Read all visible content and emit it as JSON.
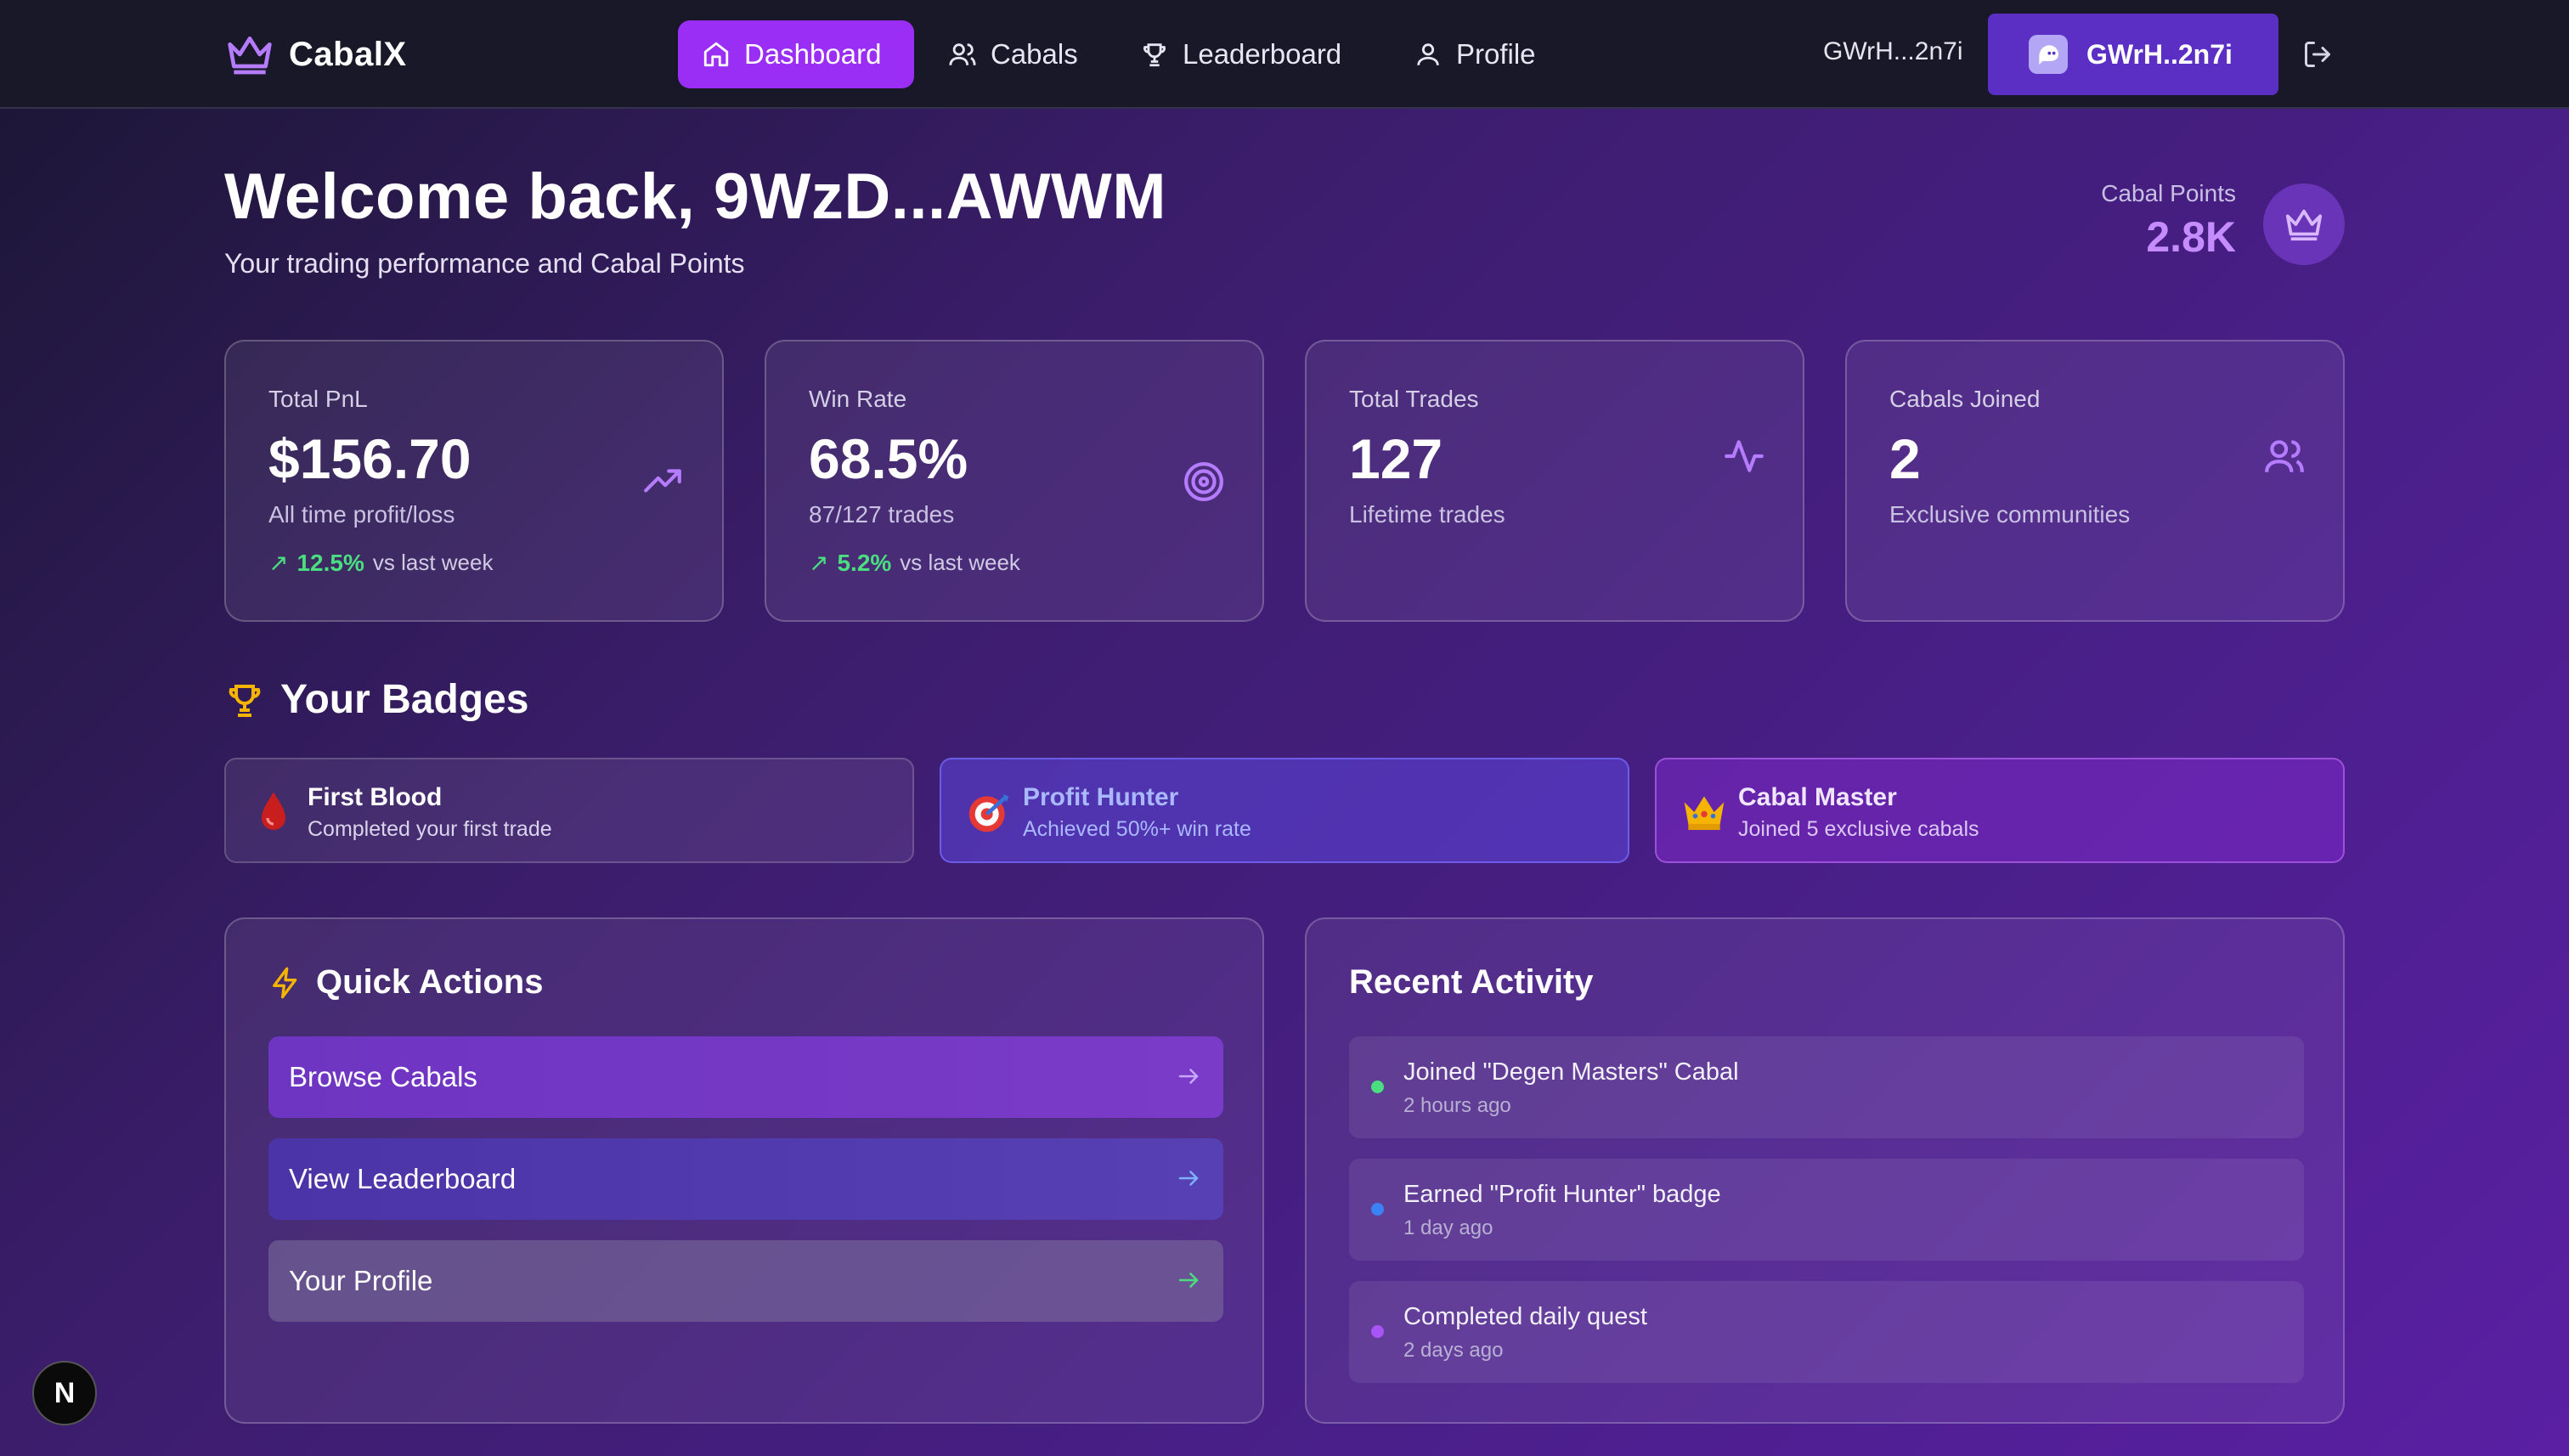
{
  "brand": {
    "name": "CabalX"
  },
  "nav": {
    "items": [
      {
        "label": "Dashboard",
        "icon": "home-icon",
        "active": true
      },
      {
        "label": "Cabals",
        "icon": "users-icon",
        "active": false
      },
      {
        "label": "Leaderboard",
        "icon": "trophy-icon",
        "active": false
      },
      {
        "label": "Profile",
        "icon": "user-icon",
        "active": false
      }
    ],
    "wallet_address": "GWrH...2n7i",
    "wallet_button_label": "GWrH..2n7i"
  },
  "header": {
    "welcome": "Welcome back, 9WzD...AWWM",
    "subtitle": "Your trading performance and Cabal Points",
    "points_label": "Cabal Points",
    "points_value": "2.8K"
  },
  "stats": [
    {
      "title": "Total PnL",
      "value": "$156.70",
      "desc": "All time profit/loss",
      "change": "12.5%",
      "change_suffix": "vs last week",
      "icon": "trending-up-icon"
    },
    {
      "title": "Win Rate",
      "value": "68.5%",
      "desc": "87/127 trades",
      "change": "5.2%",
      "change_suffix": "vs last week",
      "icon": "target-icon"
    },
    {
      "title": "Total Trades",
      "value": "127",
      "desc": "Lifetime trades",
      "icon": "activity-icon"
    },
    {
      "title": "Cabals Joined",
      "value": "2",
      "desc": "Exclusive communities",
      "icon": "users-icon"
    }
  ],
  "badges": {
    "title": "Your Badges",
    "items": [
      {
        "name": "First Blood",
        "desc": "Completed your first trade",
        "icon": "blood-drop-icon"
      },
      {
        "name": "Profit Hunter",
        "desc": "Achieved 50%+ win rate",
        "icon": "dart-target-icon"
      },
      {
        "name": "Cabal Master",
        "desc": "Joined 5 exclusive cabals",
        "icon": "crown-icon"
      }
    ]
  },
  "quick_actions": {
    "title": "Quick Actions",
    "items": [
      {
        "label": "Browse Cabals"
      },
      {
        "label": "View Leaderboard"
      },
      {
        "label": "Your Profile"
      }
    ]
  },
  "recent_activity": {
    "title": "Recent Activity",
    "items": [
      {
        "text": "Joined \"Degen Masters\" Cabal",
        "time": "2 hours ago",
        "dot_color": "#4ade80"
      },
      {
        "text": "Earned \"Profit Hunter\" badge",
        "time": "1 day ago",
        "dot_color": "#3b82f6"
      },
      {
        "text": "Completed daily quest",
        "time": "2 days ago",
        "dot_color": "#a855f7"
      }
    ]
  },
  "dev_indicator": {
    "label": "N"
  },
  "colors": {
    "accent": "#9a2ef5",
    "positive": "#4ade80",
    "points": "#c58cff"
  }
}
